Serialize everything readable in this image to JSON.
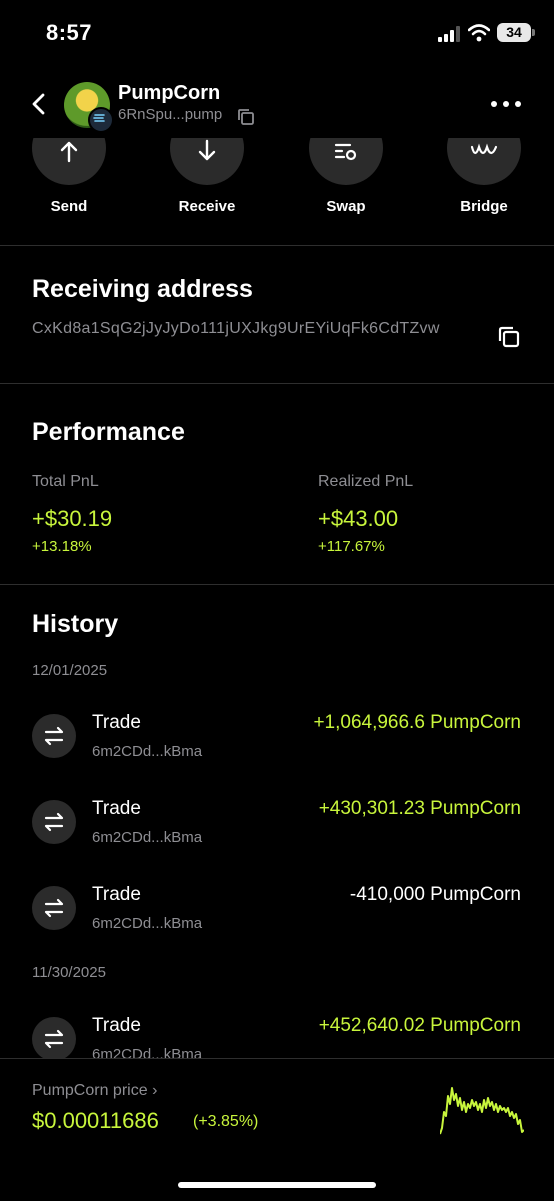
{
  "status": {
    "time": "8:57",
    "battery": "34"
  },
  "header": {
    "name": "PumpCorn",
    "address": "6RnSpu...pump"
  },
  "actions": [
    {
      "label": "Send",
      "icon": "arrow-up-icon"
    },
    {
      "label": "Receive",
      "icon": "arrow-down-icon"
    },
    {
      "label": "Swap",
      "icon": "swap-icon"
    },
    {
      "label": "Bridge",
      "icon": "bridge-icon"
    }
  ],
  "receiving": {
    "title": "Receiving address",
    "address": "CxKd8a1SqG2jJyJyDo111jUXJkg9UrEYiUqFk6CdTZvw"
  },
  "performance": {
    "title": "Performance",
    "total_label": "Total PnL",
    "total_value": "+$30.19",
    "total_pct": "+13.18%",
    "realized_label": "Realized PnL",
    "realized_value": "+$43.00",
    "realized_pct": "+117.67%"
  },
  "history": {
    "title": "History",
    "groups": [
      {
        "date": "12/01/2025",
        "items": [
          {
            "title": "Trade",
            "sub": "6m2CDd...kBma",
            "amount": "+1,064,966.6 PumpCorn"
          },
          {
            "title": "Trade",
            "sub": "6m2CDd...kBma",
            "amount": "+430,301.23 PumpCorn"
          },
          {
            "title": "Trade",
            "sub": "6m2CDd...kBma",
            "amount": "-410,000 PumpCorn"
          }
        ]
      },
      {
        "date": "11/30/2025",
        "items": [
          {
            "title": "Trade",
            "sub": "6m2CDd...kBma",
            "amount": "+452,640.02 PumpCorn"
          }
        ]
      }
    ]
  },
  "price": {
    "label": "PumpCorn price",
    "value": "$0.00011686",
    "change": "(+3.85%)"
  },
  "colors": {
    "accent": "#c8f53c",
    "background": "#000000",
    "muted": "#8e8e93",
    "card": "#2b2b2b"
  }
}
